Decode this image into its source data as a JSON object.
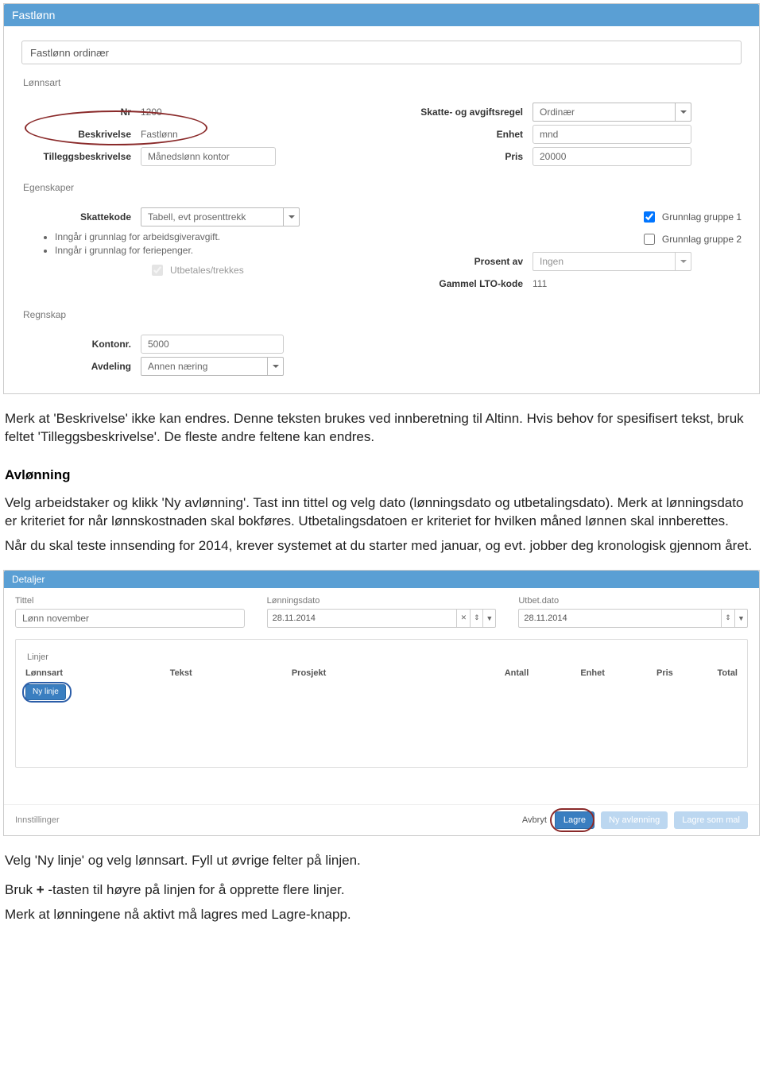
{
  "panel1": {
    "title": "Fastlønn",
    "main_input": "Fastlønn ordinær",
    "sec_lonnsart": "Lønnsart",
    "nr_label": "Nr",
    "nr_value": "1200",
    "beskr_label": "Beskrivelse",
    "beskr_value": "Fastlønn",
    "tillegg_label": "Tilleggsbeskrivelse",
    "tillegg_value": "Månedslønn kontor",
    "skatt_label": "Skatte- og avgiftsregel",
    "skatt_value": "Ordinær",
    "enhet_label": "Enhet",
    "enhet_value": "mnd",
    "pris_label": "Pris",
    "pris_value": "20000",
    "sec_egen": "Egenskaper",
    "skattekode_label": "Skattekode",
    "skattekode_value": "Tabell, evt prosenttrekk",
    "bullet1": "Inngår i grunnlag for arbeidsgiveravgift.",
    "bullet2": "Inngår i grunnlag for feriepenger.",
    "chk_utbetales": "Utbetales/trekkes",
    "chk_g1": "Grunnlag gruppe 1",
    "chk_g2": "Grunnlag gruppe 2",
    "prosent_label": "Prosent av",
    "prosent_value": "Ingen",
    "lto_label": "Gammel LTO-kode",
    "lto_value": "111",
    "sec_regnskap": "Regnskap",
    "kontonr_label": "Kontonr.",
    "kontonr_value": "5000",
    "avdeling_label": "Avdeling",
    "avdeling_value": "Annen næring"
  },
  "body1": {
    "p1": "Merk at 'Beskrivelse' ikke kan endres. Denne teksten brukes ved innberetning til Altinn. Hvis behov for spesifisert tekst, bruk feltet 'Tilleggsbeskrivelse'. De fleste andre feltene kan endres.",
    "h": "Avlønning",
    "p2a": "Velg arbeidstaker og klikk 'Ny avlønning'. Tast inn tittel og velg dato (lønningsdato og utbetalingsdato). Merk at lønningsdato er kriteriet for når lønnskostnaden skal bokføres. Utbetalingsdatoen er kriteriet for hvilken måned lønnen skal innberettes.",
    "p2b": "Når du skal teste innsending for 2014, krever systemet at du starter med januar, og evt. jobber deg kronologisk gjennom året."
  },
  "panel2": {
    "title": "Detaljer",
    "tittel_label": "Tittel",
    "tittel_value": "Lønn november",
    "lonn_label": "Lønningsdato",
    "lonn_value": "28.11.2014",
    "utbet_label": "Utbet.dato",
    "utbet_value": "28.11.2014",
    "linjer": "Linjer",
    "col_lonnsart": "Lønnsart",
    "col_tekst": "Tekst",
    "col_prosjekt": "Prosjekt",
    "col_antall": "Antall",
    "col_enhet": "Enhet",
    "col_pris": "Pris",
    "col_total": "Total",
    "btn_nylinje": "Ny linje",
    "innstillinger": "Innstillinger",
    "avbryt": "Avbryt",
    "lagre": "Lagre",
    "nyavl": "Ny avlønning",
    "lagre_mal": "Lagre som mal"
  },
  "body2": {
    "p1": "Velg 'Ny linje' og velg lønnsart. Fyll ut øvrige felter på linjen.",
    "p2a": "Bruk ",
    "p2b": " -tasten til høyre på linjen for å opprette flere linjer.",
    "p3": "Merk at lønningene nå aktivt må lagres med Lagre-knapp."
  }
}
